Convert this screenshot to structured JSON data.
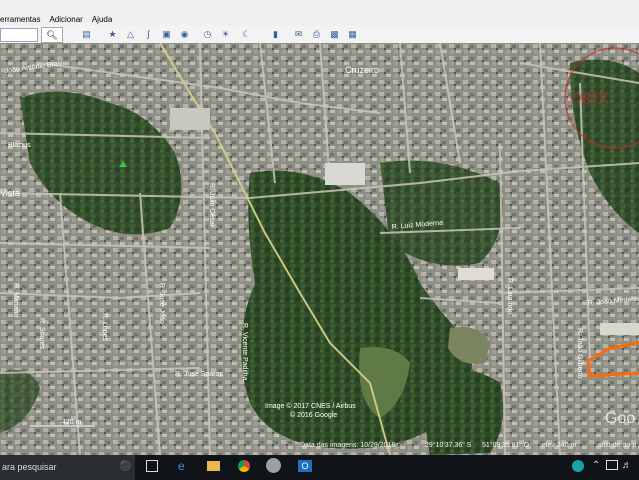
{
  "menu": {
    "items": [
      "erramentas",
      "Adicionar",
      "Ajuda"
    ]
  },
  "map": {
    "places": {
      "cruzeiro": "Cruzeiro",
      "vista": "Vista",
      "blazius": "Blazius"
    },
    "streets": {
      "antonio_brasil": "João Antônio Brasil",
      "jose_soares": "R. José Soares",
      "luiz_moderna": "R. Luiz Moderna",
      "joao_modena": "R. João Modena",
      "julio_cesar": "R. Júlio César",
      "vicente_padilha": "R. Vicente Padilha",
      "jose_joao": "R. José João",
      "lopes": "R. Lopes",
      "soares": "R. Soares",
      "mariano": "R. Mariano",
      "laurindo": "R. Laurindo",
      "joao_gilberto": "R. João Gilberto"
    },
    "scale_label": "420 m",
    "copyright_1": "Image © 2017 CNES / Airbus",
    "copyright_2": "© 2016 Google",
    "google_logo": "Goo",
    "watermark": "ORIX",
    "status": {
      "imagery_date": "Data das imagens: 10/29/2016",
      "lat": "29°10'37.36\" S",
      "lon": "51°08'35.81\" O",
      "elev": "elev  240 m",
      "eye_alt": "altitude do p"
    }
  },
  "taskbar": {
    "search_placeholder": "ara pesquisar"
  }
}
